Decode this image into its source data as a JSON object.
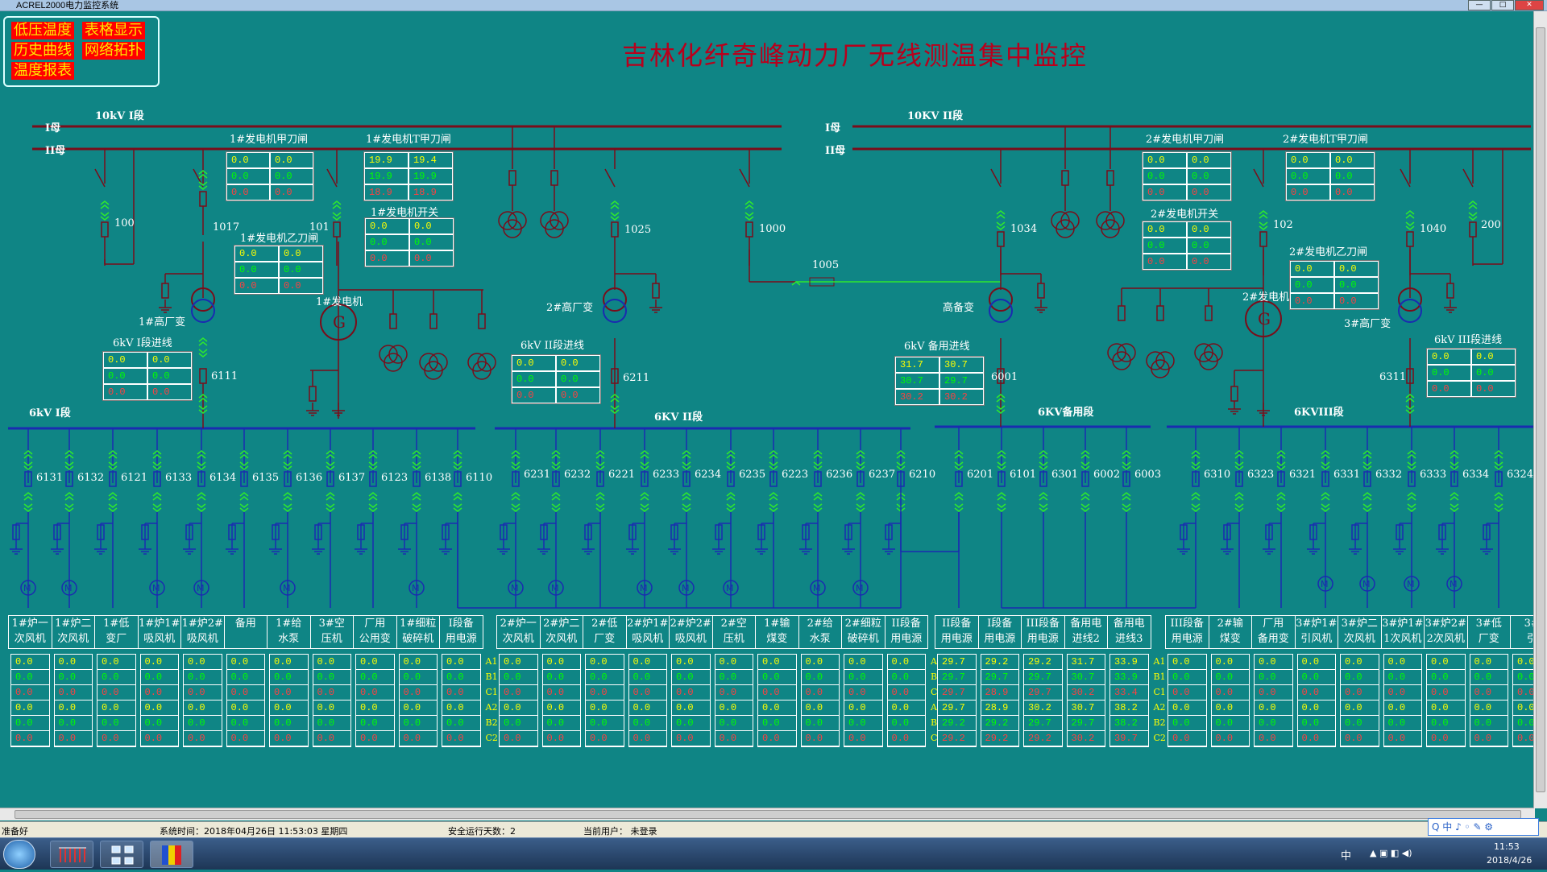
{
  "window": {
    "title": "ACREL2000电力监控系统",
    "btn_min": "—",
    "btn_max": "□",
    "btn_close": "✕"
  },
  "menu": {
    "items": [
      "低压温度",
      "表格显示",
      "历史曲线",
      "网络拓扑",
      "温度报表"
    ]
  },
  "page_title": "吉林化纤奇峰动力厂无线测温集中监控",
  "bus_10kv": {
    "section1": "10kV I段",
    "section2": "10KV II段",
    "bus_i": "I母",
    "bus_ii": "II母"
  },
  "bus_6kv": {
    "s1": "6kV I段",
    "s2": "6KV II段",
    "s3": "6KV备用段",
    "s4": "6KVIII段"
  },
  "device_labels": [
    "1#发电机甲刀闸",
    "1#发电机T甲刀闸",
    "1#发电机乙刀闸",
    "1#发电机开关",
    "2#发电机甲刀闸",
    "2#发电机T甲刀闸",
    "2#发电机开关",
    "2#发电机乙刀闸",
    "1#高厂变",
    "1#发电机",
    "2#高厂变",
    "高备变",
    "2#发电机",
    "3#高厂变",
    "6kV I段进线",
    "6kV II段进线",
    "6kV 备用进线",
    "6kV III段进线"
  ],
  "switch_numbers": [
    "100",
    "1017",
    "101",
    "1025",
    "1000",
    "1005",
    "1034",
    "102",
    "1040",
    "200",
    "6111",
    "6211",
    "6001",
    "6311"
  ],
  "boxes": [
    {
      "id": "gen1-a",
      "rows": [
        [
          "0.0",
          "0.0"
        ],
        [
          "0.0",
          "0.0"
        ],
        [
          "0.0",
          "0.0"
        ]
      ]
    },
    {
      "id": "gen1-t",
      "rows": [
        [
          "19.9",
          "19.4"
        ],
        [
          "19.9",
          "19.9"
        ],
        [
          "18.9",
          "18.9"
        ]
      ]
    },
    {
      "id": "gen1-b",
      "rows": [
        [
          "0.0",
          "0.0"
        ],
        [
          "0.0",
          "0.0"
        ],
        [
          "0.0",
          "0.0"
        ]
      ]
    },
    {
      "id": "gen1-sw",
      "rows": [
        [
          "0.0",
          "0.0"
        ],
        [
          "0.0",
          "0.0"
        ],
        [
          "0.0",
          "0.0"
        ]
      ]
    },
    {
      "id": "in1",
      "rows": [
        [
          "0.0",
          "0.0"
        ],
        [
          "0.0",
          "0.0"
        ],
        [
          "0.0",
          "0.0"
        ]
      ]
    },
    {
      "id": "in2",
      "rows": [
        [
          "0.0",
          "0.0"
        ],
        [
          "0.0",
          "0.0"
        ],
        [
          "0.0",
          "0.0"
        ]
      ]
    },
    {
      "id": "spare-in",
      "rows": [
        [
          "31.7",
          "30.7"
        ],
        [
          "30.7",
          "29.7"
        ],
        [
          "30.2",
          "30.2"
        ]
      ]
    },
    {
      "id": "gen2-a",
      "rows": [
        [
          "0.0",
          "0.0"
        ],
        [
          "0.0",
          "0.0"
        ],
        [
          "0.0",
          "0.0"
        ]
      ]
    },
    {
      "id": "gen2-t",
      "rows": [
        [
          "0.0",
          "0.0"
        ],
        [
          "0.0",
          "0.0"
        ],
        [
          "0.0",
          "0.0"
        ]
      ]
    },
    {
      "id": "gen2-sw",
      "rows": [
        [
          "0.0",
          "0.0"
        ],
        [
          "0.0",
          "0.0"
        ],
        [
          "0.0",
          "0.0"
        ]
      ]
    },
    {
      "id": "gen2-b",
      "rows": [
        [
          "0.0",
          "0.0"
        ],
        [
          "0.0",
          "0.0"
        ],
        [
          "0.0",
          "0.0"
        ]
      ]
    },
    {
      "id": "in3",
      "rows": [
        [
          "0.0",
          "0.0"
        ],
        [
          "0.0",
          "0.0"
        ],
        [
          "0.0",
          "0.0"
        ]
      ]
    }
  ],
  "feeders": {
    "g1": [
      "6131",
      "6132",
      "6121",
      "6133",
      "6134",
      "6135",
      "6136",
      "6137",
      "6123",
      "6138",
      "6110"
    ],
    "g2": [
      "6231",
      "6232",
      "6221",
      "6233",
      "6234",
      "6235",
      "6223",
      "6236",
      "6237",
      "6210"
    ],
    "g3": [
      "6201",
      "6101",
      "6301",
      "6002",
      "6003"
    ],
    "g4": [
      "6310",
      "6323",
      "6321",
      "6331",
      "6332",
      "6333",
      "6334",
      "6324"
    ]
  },
  "loads": {
    "g1": [
      "1#炉一\n次风机",
      "1#炉二\n次风机",
      "1#低\n变厂",
      "1#炉1#\n吸风机",
      "1#炉2#\n吸风机",
      "备用",
      "1#给\n水泵",
      "3#空\n压机",
      "厂用\n公用变",
      "1#细粒\n破碎机",
      "I段备\n用电源"
    ],
    "g2": [
      "2#炉一\n次风机",
      "2#炉二\n次风机",
      "2#低\n厂变",
      "2#炉1#\n吸风机",
      "2#炉2#\n吸风机",
      "2#空\n压机",
      "1#输\n煤变",
      "2#给\n水泵",
      "2#细粒\n破碎机",
      "II段备\n用电源"
    ],
    "g3": [
      "II段备\n用电源",
      "I段备\n用电源",
      "III段备\n用电源",
      "备用电\n进线2",
      "备用电\n进线3"
    ],
    "g4": [
      "III段备\n用电源",
      "2#输\n煤变",
      "厂用\n备用变",
      "3#炉1#\n引风机",
      "3#炉二\n次风机",
      "3#炉1#\n1次风机",
      "3#炉2#\n2次风机",
      "3#低\n厂变",
      "3#\n引"
    ]
  },
  "phases": [
    "A1",
    "B1",
    "C1",
    "A2",
    "B2",
    "C2"
  ],
  "temps": {
    "default": [
      "0.0",
      "0.0",
      "0.0",
      "0.0",
      "0.0",
      "0.0"
    ],
    "g3": [
      [
        "29.7",
        "29.7",
        "29.7",
        "29.7",
        "29.2",
        "29.2"
      ],
      [
        "29.2",
        "29.7",
        "28.9",
        "28.9",
        "29.2",
        "29.2"
      ],
      [
        "29.2",
        "29.7",
        "29.7",
        "30.2",
        "29.7",
        "29.2"
      ],
      [
        "31.7",
        "30.7",
        "30.2",
        "30.7",
        "29.7",
        "30.2"
      ],
      [
        "33.9",
        "33.9",
        "33.4",
        "38.2",
        "38.2",
        "39.7"
      ]
    ]
  },
  "status": {
    "ready": "准备好",
    "time": "系统时间：2018年04月26日  11:53:03   星期四",
    "days": "安全运行天数：2",
    "user": "当前用户：  未登录"
  },
  "taskbar": {
    "time": "11:53",
    "date": "2018/4/26",
    "lang": "中"
  },
  "ime": "Q 中 ♪ ◦ ✎ ⚙",
  "colors": {
    "background": "#0f8585",
    "bus": "#1a2bb0",
    "line10kv": "#7a0d1a",
    "title": "#b8001c",
    "temp_yellow": "#ffff00",
    "temp_green": "#00ff00",
    "temp_red": "#ff4040"
  }
}
